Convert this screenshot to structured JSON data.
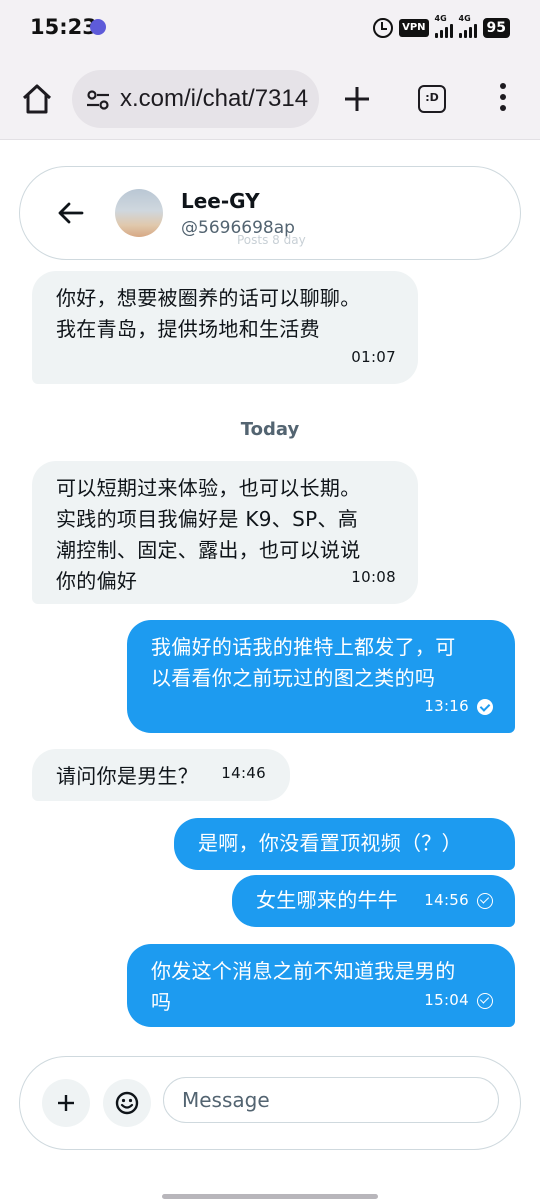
{
  "status_bar": {
    "time": "15:23",
    "vpn": "VPN",
    "net1": "4G",
    "net2": "4G",
    "battery": "95"
  },
  "browser": {
    "url": "x.com/i/chat/7314",
    "tabs_label": ":D",
    "icons": [
      "home-icon",
      "site-settings-icon",
      "plus-icon",
      "tab-switcher-icon",
      "more-vert-icon"
    ]
  },
  "chat_header": {
    "name": "Lee-GY",
    "handle": "@5696698ap",
    "ghost_text": "Posts 8 day"
  },
  "day_separator": "Today",
  "messages": [
    {
      "direction": "in",
      "text": "你好，想要被圈养的话可以聊聊。\n我在青岛，提供场地和生活费",
      "time": "01:07"
    },
    {
      "direction": "in",
      "text": "可以短期过来体验，也可以长期。\n实践的项目我偏好是 K9、SP、高\n潮控制、固定、露出，也可以说说\n你的偏好",
      "time": "10:08"
    },
    {
      "direction": "out",
      "text": "我偏好的话我的推特上都发了，可\n以看看你之前玩过的图之类的吗",
      "time": "13:16",
      "status": "read"
    },
    {
      "direction": "in",
      "text": "请问你是男生？",
      "time": "14:46"
    },
    {
      "direction": "out",
      "text": "是啊，你没看置顶视频（？）",
      "time": "",
      "status": ""
    },
    {
      "direction": "out",
      "text": "女生哪来的牛牛",
      "time": "14:56",
      "status": "sent"
    },
    {
      "direction": "out",
      "text": "你发这个消息之前不知道我是男的\n吗",
      "time": "15:04",
      "status": "sent"
    }
  ],
  "composer": {
    "placeholder": "Message"
  },
  "colors": {
    "accent": "#1d9bf0",
    "incoming_bubble": "#eff3f4",
    "browser_bar": "#f3f1f4"
  }
}
